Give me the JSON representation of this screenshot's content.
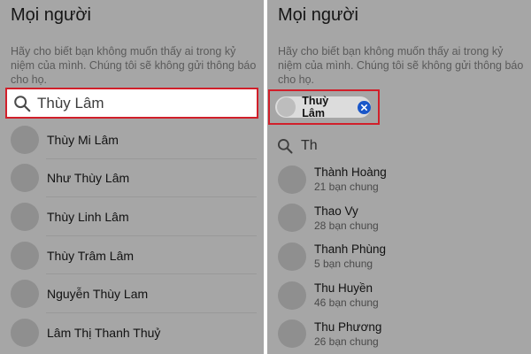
{
  "left": {
    "title": "Mọi người",
    "description": "Hãy cho biết bạn không muốn thấy ai trong kỷ niệm của mình. Chúng tôi sẽ không gửi thông báo cho họ.",
    "search_value": "Thùy Lâm",
    "results": [
      {
        "name": "Thùy Mi Lâm"
      },
      {
        "name": "Như Thùy Lâm"
      },
      {
        "name": "Thùy Linh Lâm"
      },
      {
        "name": "Thùy Trâm Lâm"
      },
      {
        "name": "Nguyễn Thùy Lam"
      },
      {
        "name": "Lâm Thị Thanh Thuỷ"
      }
    ]
  },
  "right": {
    "title": "Mọi người",
    "description": "Hãy cho biết bạn không muốn thấy ai trong kỷ niệm của mình. Chúng tôi sẽ không gửi thông báo cho họ.",
    "selected_chip": "Thuỳ Lâm",
    "search_value": "Th",
    "suggestions": [
      {
        "name": "Thành Hoàng",
        "mutual": "21 bạn chung"
      },
      {
        "name": "Thao Vy",
        "mutual": "28 bạn chung"
      },
      {
        "name": "Thanh Phùng",
        "mutual": "5 bạn chung"
      },
      {
        "name": "Thu Huyền",
        "mutual": "46 bạn chung"
      },
      {
        "name": "Thu Phương",
        "mutual": "26 bạn chung"
      }
    ]
  },
  "icons": {
    "search": "search-icon",
    "remove": "close-icon"
  },
  "colors": {
    "highlight": "#d11f2a",
    "chip_close": "#1a57c9",
    "overlay_bg": "#a6a6a6"
  }
}
